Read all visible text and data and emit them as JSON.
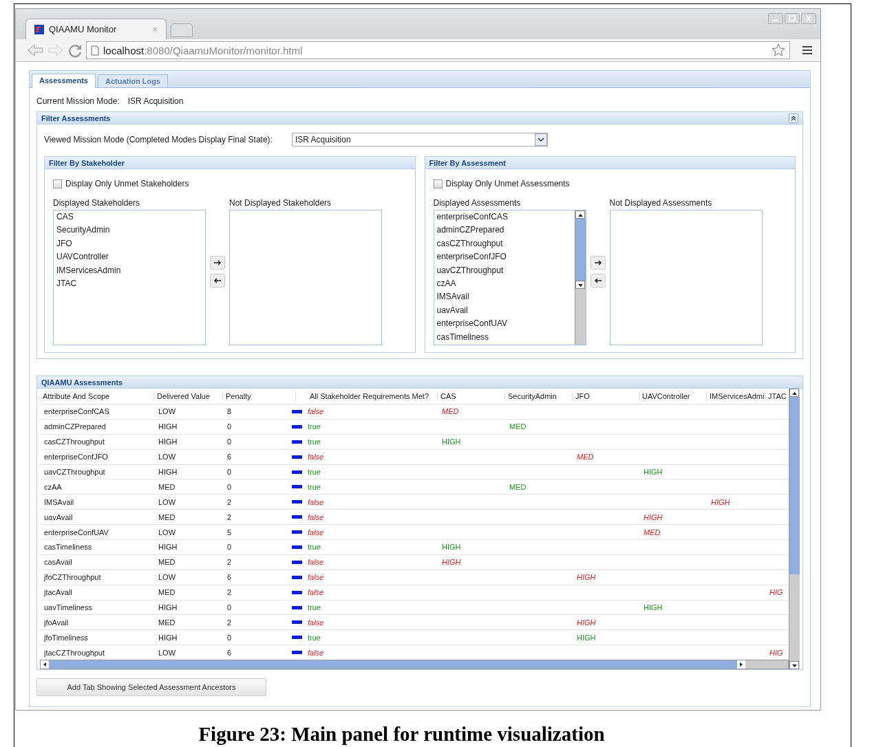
{
  "browser": {
    "tab_title": "QIAAMU Monitor",
    "tab_close": "×",
    "url_host": "localhost",
    "url_path": ":8080/QiaamuMonitor/monitor.html"
  },
  "tabs": [
    {
      "label": "Assessments",
      "selected": true
    },
    {
      "label": "Actuation Logs",
      "selected": false
    }
  ],
  "mission_mode": {
    "label": "Current Mission Mode:",
    "value": "ISR Acquisition"
  },
  "filter": {
    "title": "Filter Assessments",
    "expanded": true,
    "viewed_label": "Viewed Mission Mode (Completed Modes Display Final State):",
    "viewed_value": "ISR Acquisition",
    "panels": [
      {
        "title": "Filter By Stakeholder",
        "checkbox": {
          "label": "Display Only Unmet Stakeholders",
          "checked": false
        },
        "displayed_label": "Displayed Stakeholders",
        "displayed": [
          "CAS",
          "SecurityAdmin",
          "JFO",
          "UAVController",
          "IMServicesAdmin",
          "JTAC"
        ],
        "scrollable": false,
        "not_displayed_label": "Not Displayed Stakeholders"
      },
      {
        "title": "Filter By Assessment",
        "checkbox": {
          "label": "Display Only Unmet Assessments",
          "checked": false
        },
        "displayed_label": "Displayed Assessments",
        "displayed": [
          "enterpriseConfCAS",
          "adminCZPrepared",
          "casCZThroughput",
          "enterpriseConfJFO",
          "uavCZThroughput",
          "czAA",
          "IMSAvail",
          "uavAvail",
          "enterpriseConfUAV",
          "casTimeliness"
        ],
        "scrollable": true,
        "not_displayed_label": "Not Displayed Assessments"
      }
    ]
  },
  "assessments": {
    "title": "QIAAMU Assessments",
    "columns": [
      "Attribute And Scope",
      "Delivered Value",
      "Penalty",
      "All Stakeholder Requirements Met?",
      "CAS",
      "SecurityAdmin",
      "JFO",
      "UAVController",
      "IMServicesAdmi",
      "JTAC"
    ],
    "rows": [
      {
        "attribute": "enterpriseConfCAS",
        "delivered": "LOW",
        "penalty": "8",
        "met": false,
        "met_label": "false",
        "cas": "MED"
      },
      {
        "attribute": "adminCZPrepared",
        "delivered": "HIGH",
        "penalty": "0",
        "met": true,
        "met_label": "true",
        "security_admin": "MED"
      },
      {
        "attribute": "casCZThroughput",
        "delivered": "HIGH",
        "penalty": "0",
        "met": true,
        "met_label": "true",
        "cas": "HIGH"
      },
      {
        "attribute": "enterpriseConfJFO",
        "delivered": "LOW",
        "penalty": "6",
        "met": false,
        "met_label": "false",
        "jfo": "MED"
      },
      {
        "attribute": "uavCZThroughput",
        "delivered": "HIGH",
        "penalty": "0",
        "met": true,
        "met_label": "true",
        "uav_controller": "HIGH"
      },
      {
        "attribute": "czAA",
        "delivered": "MED",
        "penalty": "0",
        "met": true,
        "met_label": "true",
        "security_admin": "MED"
      },
      {
        "attribute": "IMSAvail",
        "delivered": "LOW",
        "penalty": "2",
        "met": false,
        "met_label": "false",
        "im_services_admin": "HIGH"
      },
      {
        "attribute": "uavAvail",
        "delivered": "MED",
        "penalty": "2",
        "met": false,
        "met_label": "false",
        "uav_controller": "HIGH"
      },
      {
        "attribute": "enterpriseConfUAV",
        "delivered": "LOW",
        "penalty": "5",
        "met": false,
        "met_label": "false",
        "uav_controller": "MED"
      },
      {
        "attribute": "casTimeliness",
        "delivered": "HIGH",
        "penalty": "0",
        "met": true,
        "met_label": "true",
        "cas": "HIGH"
      },
      {
        "attribute": "casAvail",
        "delivered": "MED",
        "penalty": "2",
        "met": false,
        "met_label": "false",
        "cas": "HIGH"
      },
      {
        "attribute": "jfoCZThroughput",
        "delivered": "LOW",
        "penalty": "6",
        "met": false,
        "met_label": "false",
        "jfo": "HIGH"
      },
      {
        "attribute": "jtacAvail",
        "delivered": "MED",
        "penalty": "2",
        "met": false,
        "met_label": "false",
        "jtac": "HIG"
      },
      {
        "attribute": "uavTimeliness",
        "delivered": "HIGH",
        "penalty": "0",
        "met": true,
        "met_label": "true",
        "uav_controller": "HIGH"
      },
      {
        "attribute": "jfoAvail",
        "delivered": "MED",
        "penalty": "2",
        "met": false,
        "met_label": "false",
        "jfo": "HIGH"
      },
      {
        "attribute": "jfoTimeliness",
        "delivered": "HIGH",
        "penalty": "0",
        "met": true,
        "met_label": "true",
        "jfo": "HIGH"
      },
      {
        "attribute": "jtacCZThroughput",
        "delivered": "LOW",
        "penalty": "6",
        "met": false,
        "met_label": "false",
        "jtac": "HIG"
      }
    ]
  },
  "button": "Add Tab Showing Selected Assessment Ancestors",
  "caption": "Figure 23: Main panel for runtime visualization"
}
